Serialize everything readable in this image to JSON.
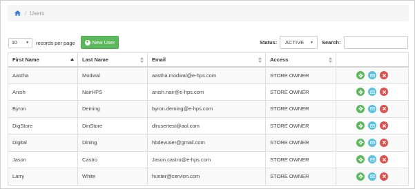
{
  "breadcrumb": {
    "current": "Users"
  },
  "controls": {
    "page_length": "10",
    "page_length_label": "records per page",
    "new_user_label": "New User",
    "status_label": "Status:",
    "status_value": "ACTIVE",
    "search_label": "Search:",
    "search_value": ""
  },
  "table": {
    "headers": [
      "First Name",
      "Last Name",
      "Email",
      "Access",
      ""
    ],
    "sorted_column": "First Name",
    "rows": [
      {
        "first": "Aastha",
        "last": "Modwal",
        "email": "aastha.modwal@e-hps.com",
        "access": "STORE OWNER"
      },
      {
        "first": "Anish",
        "last": "NairHPS",
        "email": "anish.nair@e-hps.com",
        "access": "STORE OWNER"
      },
      {
        "first": "Byron",
        "last": "Deming",
        "email": "byron.deming@e-hps.com",
        "access": "STORE OWNER"
      },
      {
        "first": "DigStore",
        "last": "DinStore",
        "email": "dlrusertest@aol.com",
        "access": "STORE OWNER"
      },
      {
        "first": "Digital",
        "last": "Dining",
        "email": "hbdevuser@gmail.com",
        "access": "STORE OWNER"
      },
      {
        "first": "Jason",
        "last": "Castro",
        "email": "Jason.castro@e-hps.com",
        "access": "STORE OWNER"
      },
      {
        "first": "Larry",
        "last": "White",
        "email": "hunter@cervion.com",
        "access": "STORE OWNER"
      }
    ]
  },
  "colors": {
    "edit": "#5cb85c",
    "email": "#5bc0de",
    "delete": "#d9534f",
    "new_user": "#5cb85c"
  },
  "icons": {
    "home": "home-icon",
    "edit": "gear-icon",
    "email": "envelope-icon",
    "delete": "close-icon"
  }
}
